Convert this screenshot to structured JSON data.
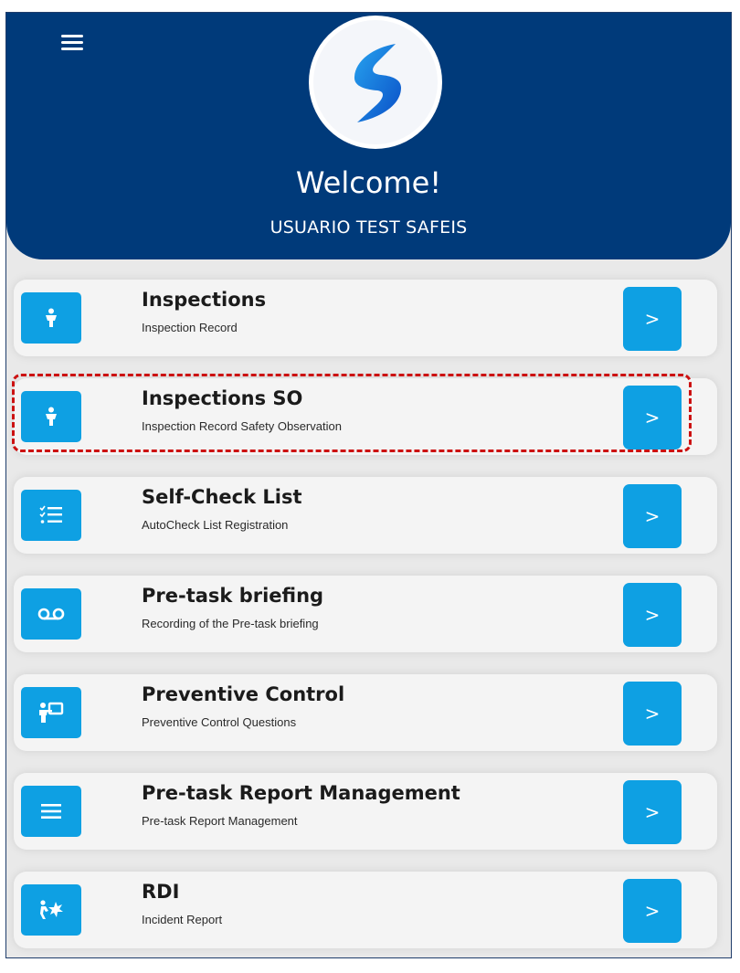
{
  "header": {
    "welcome": "Welcome!",
    "user_name": "USUARIO TEST SAFEIS",
    "menu_icon": "hamburger-menu-icon",
    "logo_icon": "swoosh-logo-icon"
  },
  "colors": {
    "header_bg": "#003a7a",
    "accent": "#0ea0e3",
    "highlight": "#cc1111"
  },
  "menu": {
    "items": [
      {
        "title": "Inspections",
        "subtitle": "Inspection Record",
        "icon": "person-icon",
        "action": ">"
      },
      {
        "title": "Inspections SO",
        "subtitle": "Inspection Record Safety Observation",
        "icon": "person-icon",
        "action": ">"
      },
      {
        "title": "Self-Check List",
        "subtitle": "AutoCheck List Registration",
        "icon": "checklist-icon",
        "action": ">"
      },
      {
        "title": "Pre-task briefing",
        "subtitle": "Recording of the Pre-task briefing",
        "icon": "voicemail-icon",
        "action": ">"
      },
      {
        "title": "Preventive Control",
        "subtitle": "Preventive Control Questions",
        "icon": "presenter-icon",
        "action": ">"
      },
      {
        "title": "Pre-task Report Management",
        "subtitle": "Pre-task Report Management",
        "icon": "list-lines-icon",
        "action": ">"
      },
      {
        "title": "RDI",
        "subtitle": "Incident Report",
        "icon": "incident-icon",
        "action": ">"
      }
    ]
  }
}
